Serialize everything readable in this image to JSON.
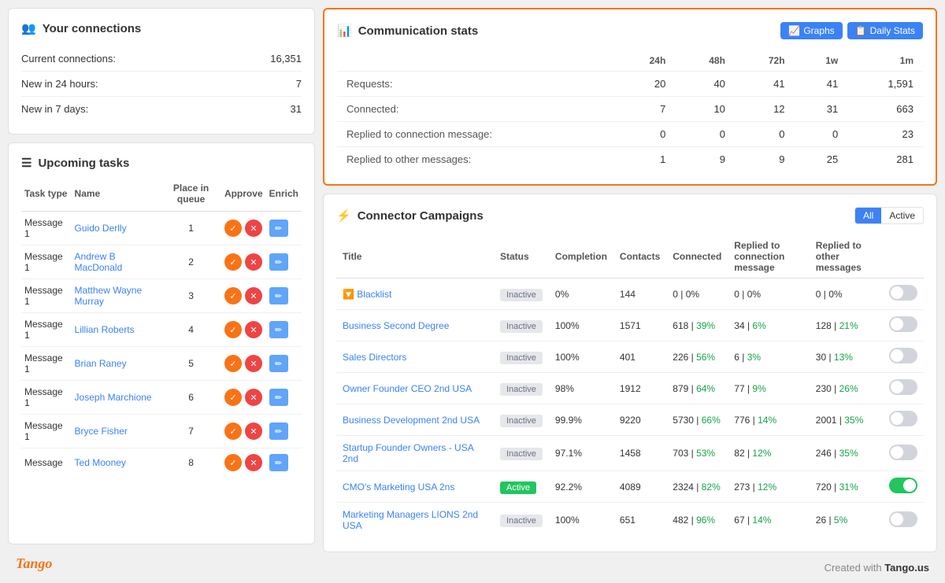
{
  "connections": {
    "title": "Your connections",
    "rows": [
      {
        "label": "Current connections:",
        "value": "16,351"
      },
      {
        "label": "New in 24 hours:",
        "value": "7"
      },
      {
        "label": "New in 7 days:",
        "value": "31"
      }
    ]
  },
  "tasks": {
    "title": "Upcoming tasks",
    "columns": [
      "Task type",
      "Name",
      "Place in queue",
      "Approve",
      "Enrich"
    ],
    "rows": [
      {
        "type": "Message 1",
        "name": "Guido Derlly",
        "queue": "1"
      },
      {
        "type": "Message 1",
        "name": "Andrew B MacDonald",
        "queue": "2"
      },
      {
        "type": "Message 1",
        "name": "Matthew Wayne Murray",
        "queue": "3"
      },
      {
        "type": "Message 1",
        "name": "Lillian Roberts",
        "queue": "4"
      },
      {
        "type": "Message 1",
        "name": "Brian Raney",
        "queue": "5"
      },
      {
        "type": "Message 1",
        "name": "Joseph Marchione",
        "queue": "6"
      },
      {
        "type": "Message 1",
        "name": "Bryce Fisher",
        "queue": "7"
      },
      {
        "type": "Message",
        "name": "Ted Mooney",
        "queue": "8"
      }
    ]
  },
  "comm_stats": {
    "title": "Communication stats",
    "btn_graphs": "Graphs",
    "btn_daily": "Daily Stats",
    "columns": [
      "",
      "24h",
      "48h",
      "72h",
      "1w",
      "1m"
    ],
    "rows": [
      {
        "label": "Requests:",
        "v24": "20",
        "v48": "40",
        "v72": "41",
        "v1w": "41",
        "v1m": "1,591"
      },
      {
        "label": "Connected:",
        "v24": "7",
        "v48": "10",
        "v72": "12",
        "v1w": "31",
        "v1m": "663"
      },
      {
        "label": "Replied to connection message:",
        "v24": "0",
        "v48": "0",
        "v72": "0",
        "v1w": "0",
        "v1m": "23"
      },
      {
        "label": "Replied to other messages:",
        "v24": "1",
        "v48": "9",
        "v72": "9",
        "v1w": "25",
        "v1m": "281"
      }
    ]
  },
  "campaigns": {
    "title": "Connector Campaigns",
    "filter_all": "All",
    "filter_active": "Active",
    "col_title": "Title",
    "col_status": "Status",
    "col_completion": "Completion",
    "col_contacts": "Contacts",
    "col_connected": "Connected",
    "col_replied_conn": "Replied to connection message",
    "col_replied_other": "Replied to other messages",
    "rows": [
      {
        "title": "Blacklist",
        "status": "Inactive",
        "status_type": "inactive",
        "completion": "0%",
        "contacts": "144",
        "connected": "0 | 0%",
        "connected_green": "",
        "replied_conn": "0 | 0%",
        "replied_conn_green": "",
        "replied_other": "0 | 0%",
        "replied_other_green": "",
        "toggle": false,
        "has_filter": true
      },
      {
        "title": "Business Second Degree",
        "status": "Inactive",
        "status_type": "inactive",
        "completion": "100%",
        "contacts": "1571",
        "connected": "618 | ",
        "connected_green": "39%",
        "replied_conn": "34 | ",
        "replied_conn_green": "6%",
        "replied_other": "128 | ",
        "replied_other_green": "21%",
        "toggle": false,
        "has_filter": false
      },
      {
        "title": "Sales Directors",
        "status": "Inactive",
        "status_type": "inactive",
        "completion": "100%",
        "contacts": "401",
        "connected": "226 | ",
        "connected_green": "56%",
        "replied_conn": "6 | ",
        "replied_conn_green": "3%",
        "replied_other": "30 | ",
        "replied_other_green": "13%",
        "toggle": false,
        "has_filter": false
      },
      {
        "title": "Owner Founder CEO 2nd USA",
        "status": "Inactive",
        "status_type": "inactive",
        "completion": "98%",
        "contacts": "1912",
        "connected": "879 | ",
        "connected_green": "64%",
        "replied_conn": "77 | ",
        "replied_conn_green": "9%",
        "replied_other": "230 | ",
        "replied_other_green": "26%",
        "toggle": false,
        "has_filter": false
      },
      {
        "title": "Business Development 2nd USA",
        "status": "Inactive",
        "status_type": "inactive",
        "completion": "99.9%",
        "contacts": "9220",
        "connected": "5730 | ",
        "connected_green": "66%",
        "replied_conn": "776 | ",
        "replied_conn_green": "14%",
        "replied_other": "2001 | ",
        "replied_other_green": "35%",
        "toggle": false,
        "has_filter": false
      },
      {
        "title": "Startup Founder Owners - USA 2nd",
        "status": "Inactive",
        "status_type": "inactive",
        "completion": "97.1%",
        "contacts": "1458",
        "connected": "703 | ",
        "connected_green": "53%",
        "replied_conn": "82 | ",
        "replied_conn_green": "12%",
        "replied_other": "246 | ",
        "replied_other_green": "35%",
        "toggle": false,
        "has_filter": false
      },
      {
        "title": "CMO's Marketing USA 2ns",
        "status": "Active",
        "status_type": "active",
        "completion": "92.2%",
        "contacts": "4089",
        "connected": "2324 | ",
        "connected_green": "82%",
        "replied_conn": "273 | ",
        "replied_conn_green": "12%",
        "replied_other": "720 | ",
        "replied_other_green": "31%",
        "toggle": true,
        "has_filter": false
      },
      {
        "title": "Marketing Managers LIONS 2nd USA",
        "status": "Inactive",
        "status_type": "inactive",
        "completion": "100%",
        "contacts": "651",
        "connected": "482 | ",
        "connected_green": "96%",
        "replied_conn": "67 | ",
        "replied_conn_green": "14%",
        "replied_other": "26 | ",
        "replied_other_green": "5%",
        "toggle": false,
        "has_filter": false
      }
    ]
  },
  "footer": {
    "logo": "Tango",
    "created": "Created with Tango.us"
  }
}
